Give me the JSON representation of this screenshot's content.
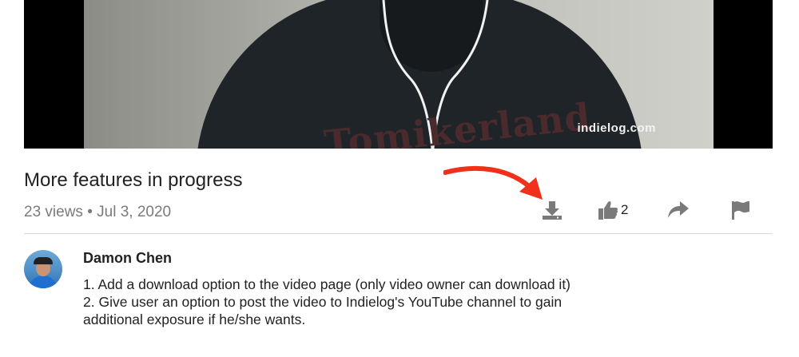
{
  "video": {
    "watermark": "indielog.com",
    "shirt_print": "Tomikerland"
  },
  "post": {
    "title": "More features in progress",
    "views": "23 views",
    "separator": "•",
    "date": "Jul 3, 2020"
  },
  "actions": {
    "download_icon": "download-icon",
    "like_icon": "thumbs-up-icon",
    "like_count": "2",
    "share_icon": "share-icon",
    "flag_icon": "flag-icon",
    "annotation_arrow_color": "#f0301c"
  },
  "comment": {
    "author": "Damon Chen",
    "lines": [
      "1. Add a download option to the video page (only video owner can download it)",
      "2. Give user an option to post the video to Indielog's YouTube channel to gain additional exposure if he/she wants."
    ]
  }
}
